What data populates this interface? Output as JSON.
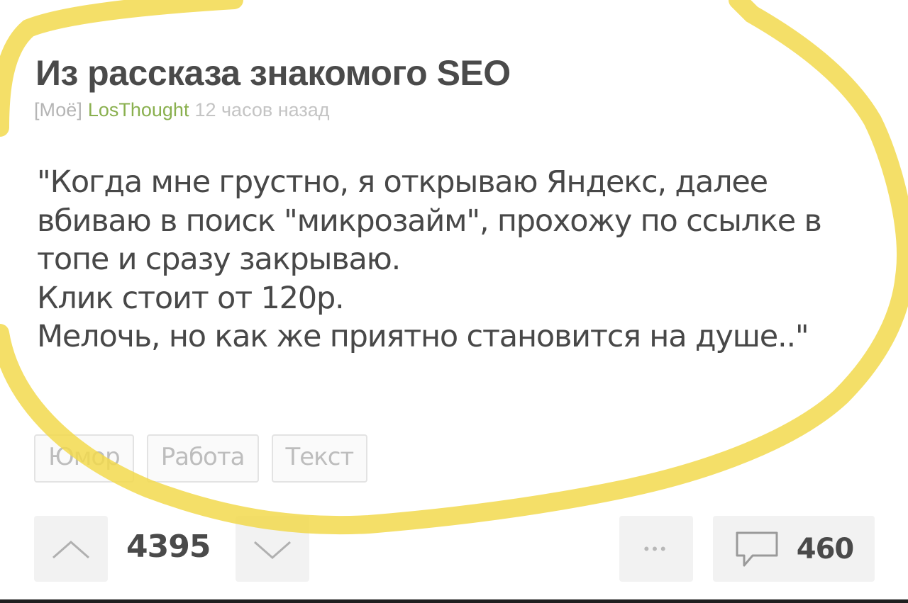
{
  "post": {
    "title": "Из рассказа знакомого SEO",
    "meta": {
      "label": "[Моё]",
      "author": "LosThought",
      "time": "12 часов назад"
    },
    "body_lines": [
      "\"Когда мне грустно, я открываю Яндекс, далее",
      "вбиваю в поиск \"микрозайм\", прохожу по ссылке в",
      "топе и сразу закрываю.",
      "Клик стоит от 120р.",
      "Мелочь, но как же приятно становится на душе..\""
    ],
    "tags": [
      "Юмор",
      "Работа",
      "Текст"
    ]
  },
  "actions": {
    "rating": "4395",
    "comments_count": "460",
    "upvote_icon": "chevron-up-icon",
    "downvote_icon": "chevron-down-icon",
    "more_icon": "more-dots-icon",
    "comment_icon": "comment-bubble-icon"
  },
  "colors": {
    "highlight_stroke": "#f2d94e",
    "author": "#8ab04f",
    "meta_gray": "#b5b5b5",
    "button_bg": "#f2f2f2"
  }
}
